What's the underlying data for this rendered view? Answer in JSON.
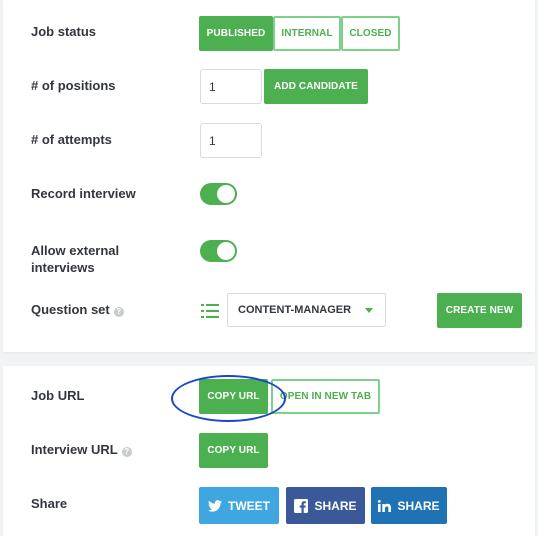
{
  "settings": {
    "job_status": {
      "label": "Job status",
      "options": [
        "PUBLISHED",
        "INTERNAL",
        "CLOSED"
      ],
      "selected": "PUBLISHED"
    },
    "positions": {
      "label": "# of positions",
      "value": "1",
      "add_candidate_label": "ADD CANDIDATE"
    },
    "attempts": {
      "label": "# of attempts",
      "value": "1"
    },
    "record_interview": {
      "label": "Record interview",
      "enabled": true
    },
    "allow_external": {
      "label_line1": "Allow external",
      "label_line2": "interviews",
      "enabled": true
    },
    "question_set": {
      "label": "Question set",
      "help": "?",
      "selected": "CONTENT-MANAGER",
      "create_new_label": "CREATE NEW"
    }
  },
  "links": {
    "job_url": {
      "label": "Job URL",
      "copy_label": "COPY URL",
      "open_label": "OPEN IN NEW TAB"
    },
    "interview_url": {
      "label": "Interview URL",
      "help": "?",
      "copy_label": "COPY URL"
    },
    "share": {
      "label": "Share",
      "tweet_label": "TWEET",
      "facebook_label": "SHARE",
      "linkedin_label": "SHARE"
    }
  },
  "colors": {
    "primary_green": "#4caf50",
    "twitter_blue": "#3fa6df",
    "facebook_blue": "#3b5998",
    "linkedin_blue": "#1f73b5",
    "annotation_oval": "#1847c9"
  },
  "icons": [
    "list-icon",
    "caret-down-icon",
    "help-icon",
    "twitter-icon",
    "facebook-icon",
    "linkedin-icon"
  ]
}
